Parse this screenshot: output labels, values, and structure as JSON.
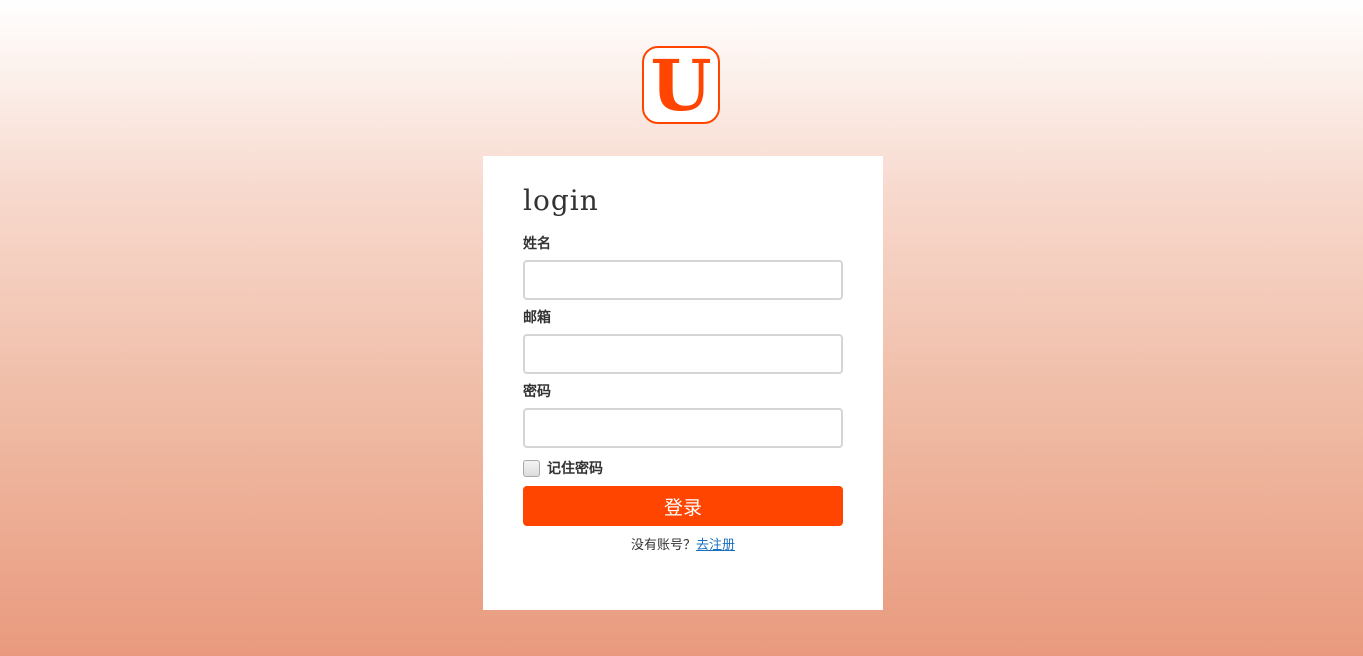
{
  "logo": {
    "letter": "U",
    "color": "#ff4500"
  },
  "form": {
    "title": "login",
    "fields": [
      {
        "label": "姓名",
        "value": "",
        "placeholder": ""
      },
      {
        "label": "邮箱",
        "value": "",
        "placeholder": ""
      },
      {
        "label": "密码",
        "value": "",
        "placeholder": ""
      }
    ],
    "remember_label": "记住密码",
    "remember_checked": false,
    "submit_label": "登录",
    "footer_text": "没有账号？",
    "register_link": "去注册",
    "accent_color": "#ff4500"
  }
}
